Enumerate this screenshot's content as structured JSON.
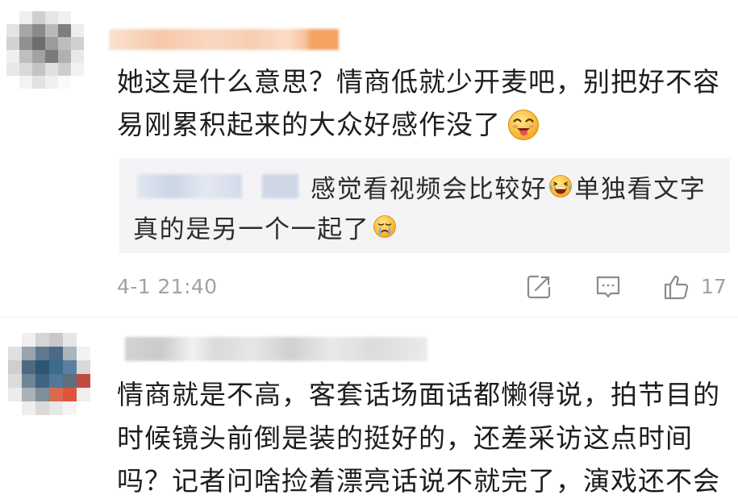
{
  "theme": {
    "page_bg": "#ffffff",
    "text": "#1d1d1d",
    "reply_text": "#2c2c2c",
    "muted": "#a2a2a2",
    "reply_bg": "#f4f4f6",
    "icon": "#8b8b8b"
  },
  "comments": [
    {
      "body_lines": [
        "她这是什么意思？情商低就少开麦吧，别把好不容",
        "易刚累积起来的大众好感作没了"
      ],
      "body_emoji": "drool-emoji-icon",
      "reply": {
        "lines": [
          [
            {
              "text": "感觉看视频会比较好"
            },
            {
              "emoji": "laughing-tears-emoji-icon"
            },
            {
              "text": "单独看文字"
            }
          ],
          [
            {
              "text": "真的是另一个一起了"
            },
            {
              "emoji": "crying-emoji-icon"
            }
          ]
        ]
      },
      "timestamp": "4-1 21:40",
      "actions": {
        "share": "share-icon",
        "comment": "comment-icon",
        "like": "like-icon",
        "like_count": "17"
      }
    },
    {
      "body_lines": [
        "情商就是不高，客套话场面话都懒得说，拍节目的",
        "时候镜头前倒是装的挺好的，还差采访这点时间",
        "吗？记者问啥捡着漂亮话说不就完了，演戏还不会"
      ]
    }
  ]
}
